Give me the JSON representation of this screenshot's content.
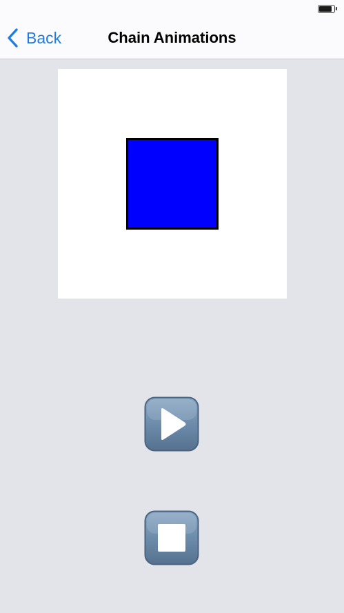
{
  "status_bar": {
    "battery_icon": "battery-icon",
    "battery_level": 0.85
  },
  "nav": {
    "back_label": "Back",
    "back_icon": "chevron-left-icon",
    "title": "Chain Animations"
  },
  "canvas": {
    "square_color": "#0000ff",
    "square_border": "#000000"
  },
  "controls": {
    "play_icon": "play-icon",
    "stop_icon": "stop-icon",
    "button_color": "#6b89a8"
  },
  "colors": {
    "accent": "#1f7ce0",
    "background": "#e3e4ea",
    "bar": "#fbfbfd"
  }
}
